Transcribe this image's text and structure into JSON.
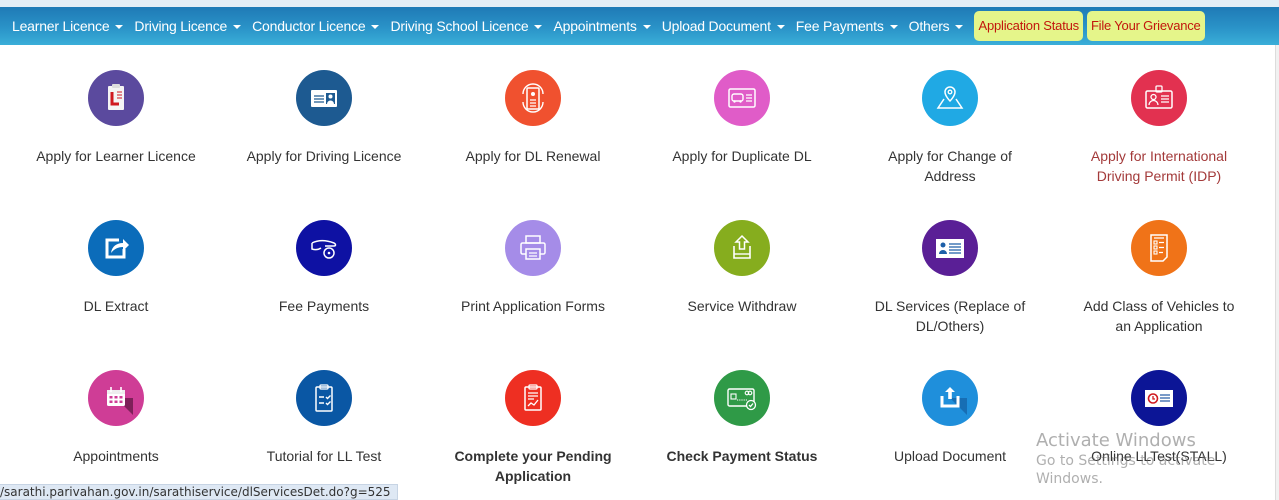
{
  "nav": {
    "items": [
      {
        "label": "Learner Licence",
        "dropdown": true
      },
      {
        "label": "Driving Licence",
        "dropdown": true
      },
      {
        "label": "Conductor Licence",
        "dropdown": true
      },
      {
        "label": "Driving School Licence",
        "dropdown": true
      },
      {
        "label": "Appointments",
        "dropdown": true
      },
      {
        "label": "Upload Document",
        "dropdown": true
      },
      {
        "label": "Fee Payments",
        "dropdown": true
      },
      {
        "label": "Others",
        "dropdown": true
      }
    ],
    "highlight_buttons": [
      {
        "label": "Application Status"
      },
      {
        "label": "File Your Grievance"
      }
    ]
  },
  "services": [
    {
      "label": "Apply for Learner Licence",
      "icon": "learner-licence-icon",
      "color": "#5b4a9e"
    },
    {
      "label": "Apply for Driving Licence",
      "icon": "id-card-icon",
      "color": "#1d5a91"
    },
    {
      "label": "Apply for DL Renewal",
      "icon": "renewal-icon",
      "color": "#f0512f"
    },
    {
      "label": "Apply for Duplicate DL",
      "icon": "duplicate-card-icon",
      "color": "#e05cc8"
    },
    {
      "label": "Apply for Change of Address",
      "icon": "location-pin-icon",
      "color": "#20a9e4"
    },
    {
      "label": "Apply for International Driving Permit (IDP)",
      "icon": "badge-icon",
      "color": "#e23150",
      "style": "red"
    },
    {
      "label": "DL Extract",
      "icon": "share-icon",
      "color": "#0b6cba"
    },
    {
      "label": "Fee Payments",
      "icon": "hand-coin-icon",
      "color": "#0e11a3"
    },
    {
      "label": "Print Application Forms",
      "icon": "printer-icon",
      "color": "#a58ce8"
    },
    {
      "label": "Service Withdraw",
      "icon": "withdraw-icon",
      "color": "#86ad1e"
    },
    {
      "label": "DL Services (Replace of DL/Others)",
      "icon": "profile-card-icon",
      "color": "#5a1f96"
    },
    {
      "label": "Add Class of Vehicles to an Application",
      "icon": "checklist-icon",
      "color": "#f07318"
    },
    {
      "label": "Appointments",
      "icon": "calendar-icon",
      "color": "#cf3d96"
    },
    {
      "label": "Tutorial for LL Test",
      "icon": "clipboard-check-icon",
      "color": "#0a57a4"
    },
    {
      "label": "Complete your Pending Application",
      "icon": "report-icon",
      "color": "#ee2f22",
      "style": "bold"
    },
    {
      "label": "Check Payment Status",
      "icon": "payment-card-icon",
      "color": "#2f9a47",
      "style": "bold"
    },
    {
      "label": "Upload Document",
      "icon": "upload-icon",
      "color": "#1f8fdb"
    },
    {
      "label": "Online LLTest(STALL)",
      "icon": "timer-card-icon",
      "color": "#0c1596"
    }
  ],
  "status_url": "/sarathi.parivahan.gov.in/sarathiservice/dlServicesDet.do?g=525",
  "watermark": {
    "line1": "Activate Windows",
    "line2": "Go to Settings to activate Windows."
  }
}
